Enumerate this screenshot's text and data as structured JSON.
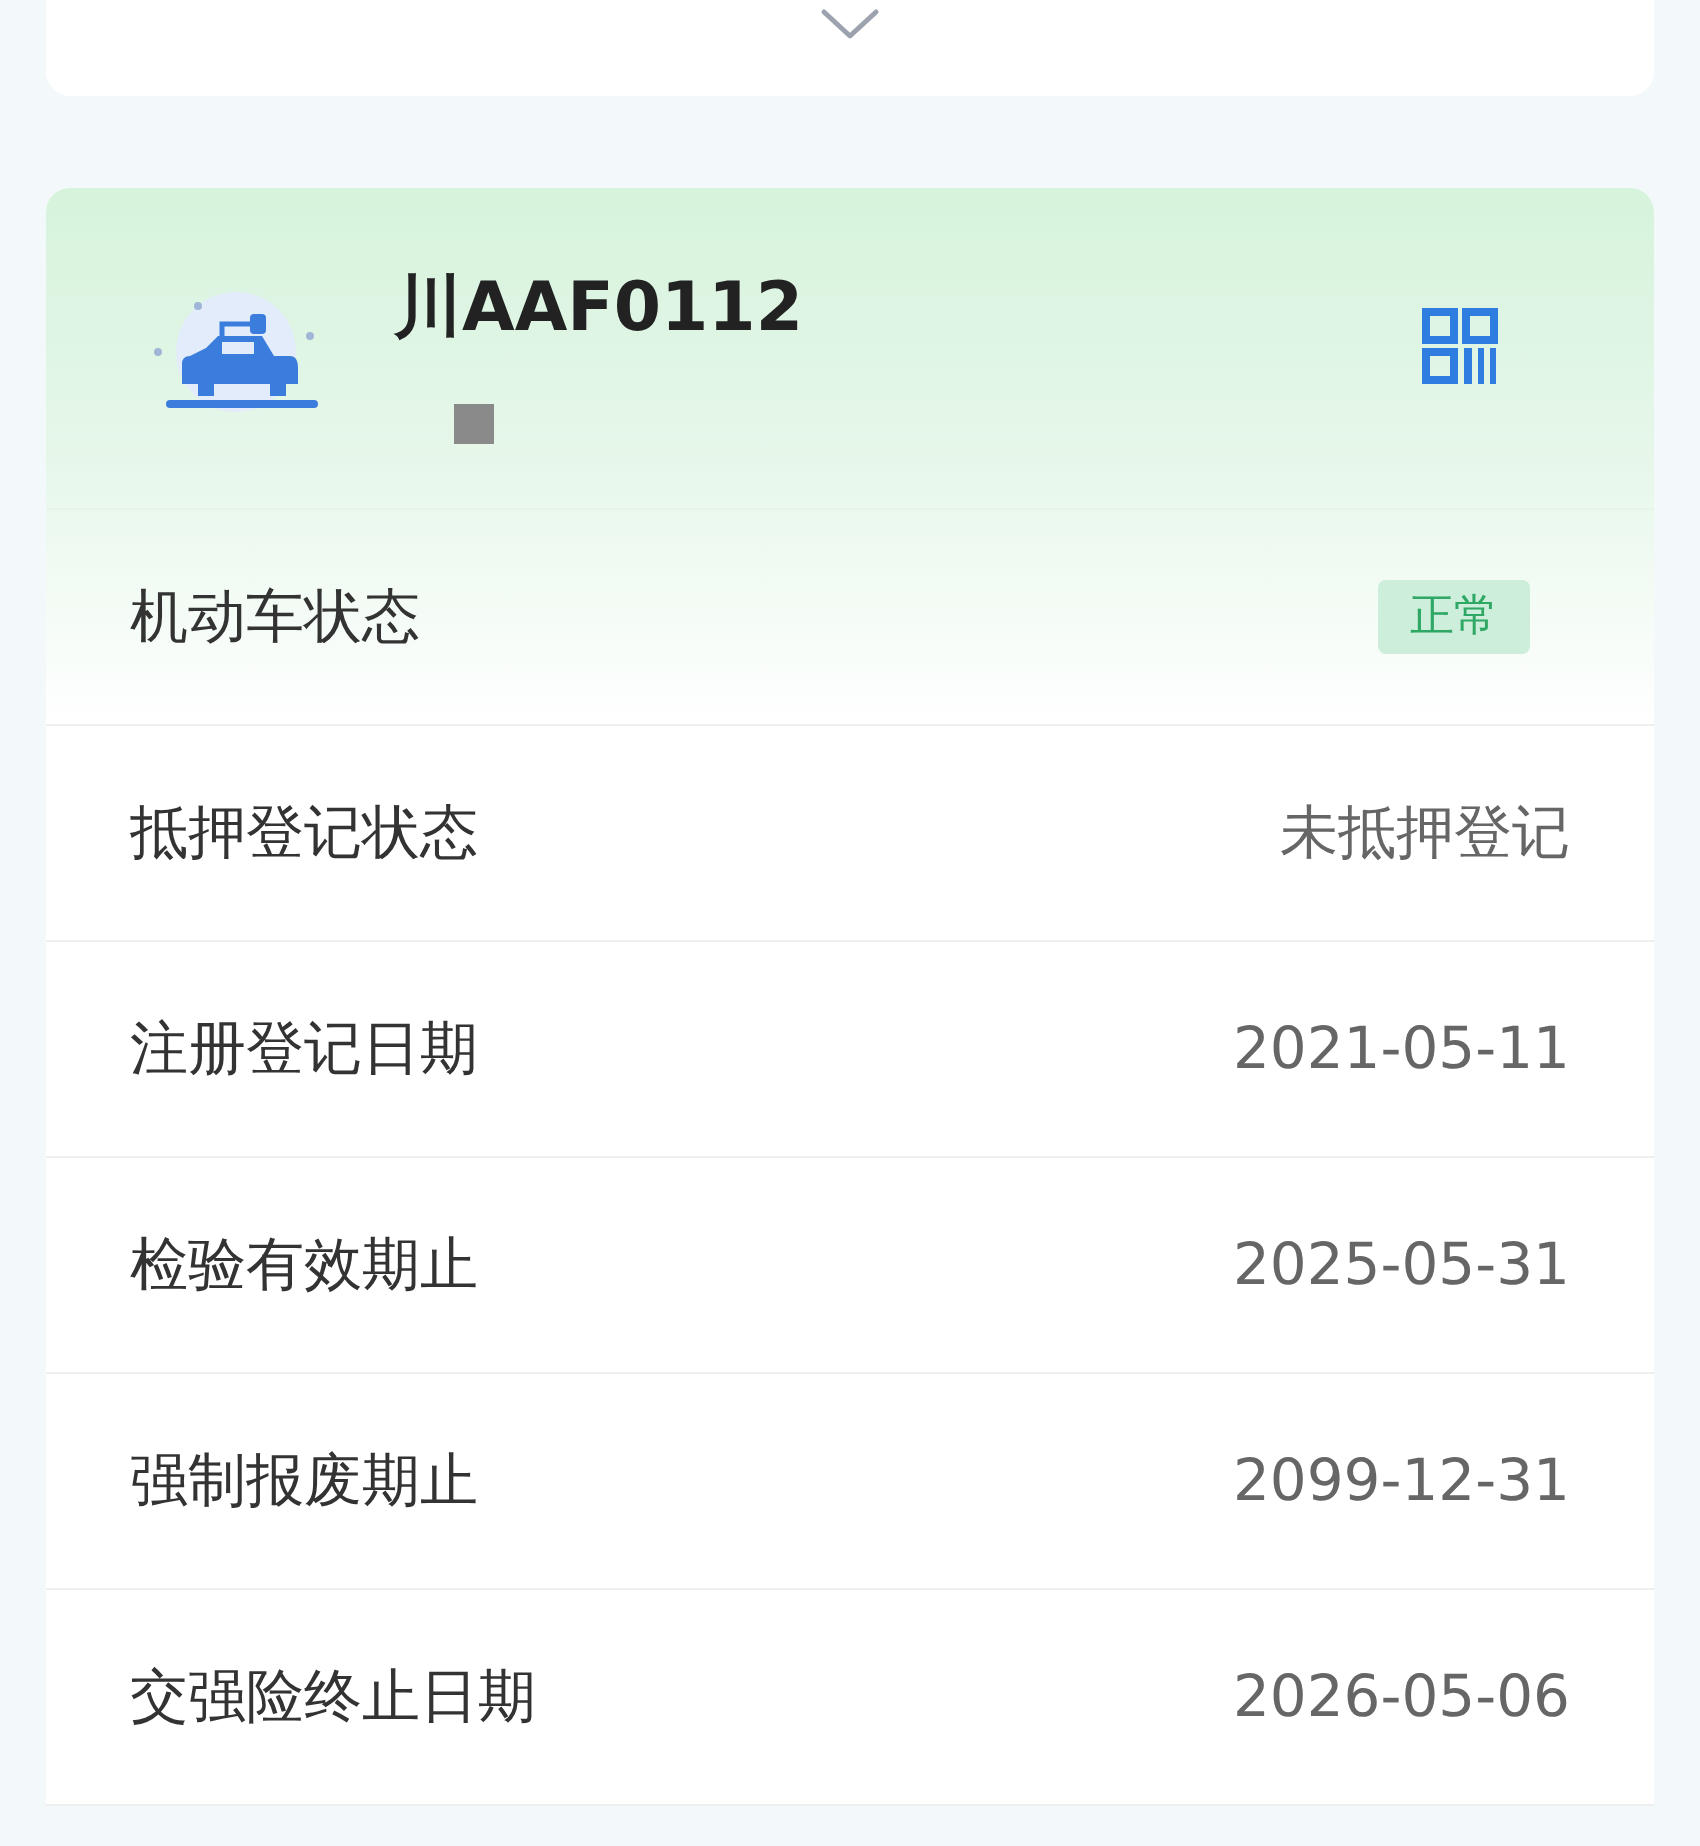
{
  "vehicle": {
    "plate": "川AAF0112"
  },
  "rows": [
    {
      "label": "机动车状态",
      "value": "正常",
      "kind": "badge"
    },
    {
      "label": "抵押登记状态",
      "value": "未抵押登记",
      "kind": "text"
    },
    {
      "label": "注册登记日期",
      "value": "2021-05-11",
      "kind": "text"
    },
    {
      "label": "检验有效期止",
      "value": "2025-05-31",
      "kind": "text"
    },
    {
      "label": "强制报废期止",
      "value": "2099-12-31",
      "kind": "text"
    },
    {
      "label": "交强险终止日期",
      "value": "2026-05-06",
      "kind": "text"
    }
  ]
}
